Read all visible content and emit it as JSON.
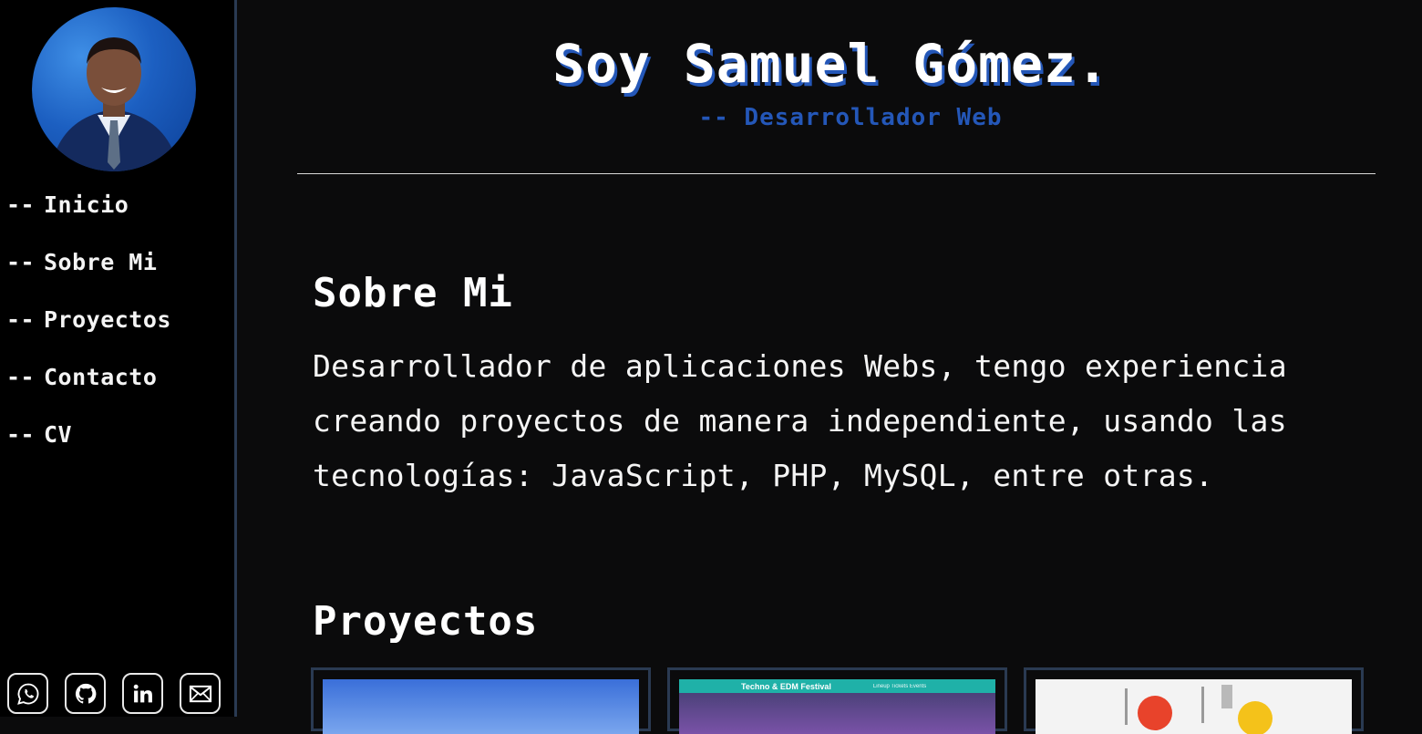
{
  "sidebar": {
    "nav": [
      {
        "prefix": "--",
        "label": "Inicio"
      },
      {
        "prefix": "--",
        "label": "Sobre Mi"
      },
      {
        "prefix": "--",
        "label": "Proyectos"
      },
      {
        "prefix": "--",
        "label": "Contacto"
      },
      {
        "prefix": "--",
        "label": "CV"
      }
    ],
    "socials": [
      "whatsapp-icon",
      "github-icon",
      "linkedin-icon",
      "mail-icon"
    ]
  },
  "hero": {
    "title": "Soy Samuel Gómez.",
    "subtitle": "-- Desarrollador Web"
  },
  "about": {
    "heading": "Sobre Mi",
    "text": "Desarrollador de aplicaciones Webs, tengo experiencia creando proyectos de manera independiente, usando las tecnologías: JavaScript, PHP, MySQL, entre otras."
  },
  "projects": {
    "heading": "Proyectos",
    "cards": [
      {
        "thumb": "sky-image"
      },
      {
        "thumb": "festival-site",
        "bar_title": "Techno & EDM Festival",
        "bar_menu": "Lineup  Tickets  Events"
      },
      {
        "thumb": "illustration"
      }
    ]
  },
  "colors": {
    "accent": "#2457b8",
    "background": "#0b0b0c",
    "sidebar": "#000000",
    "border": "#2a3a52"
  }
}
